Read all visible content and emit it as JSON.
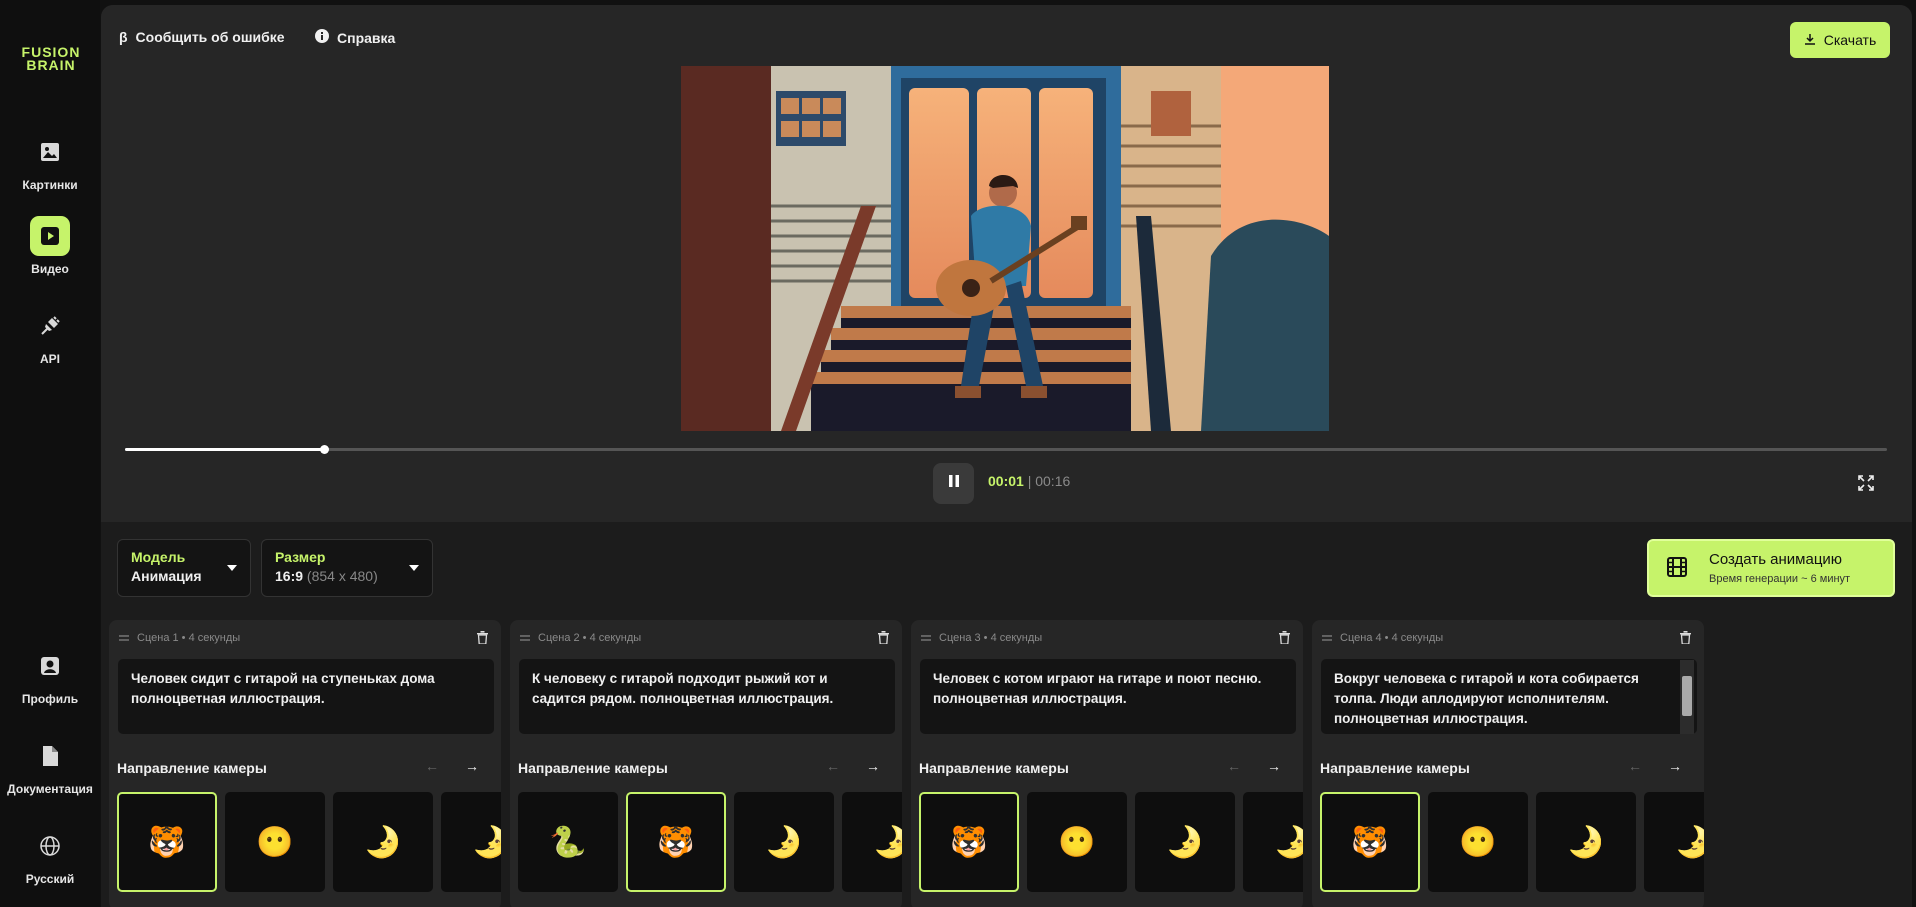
{
  "sidebar": {
    "logo": "FUSION BRAIN",
    "items": [
      {
        "label": "Картинки",
        "icon": "image-icon"
      },
      {
        "label": "Видео",
        "icon": "video-play-icon",
        "active": true
      },
      {
        "label": "API",
        "icon": "plug-icon"
      },
      {
        "label": "Профиль",
        "icon": "user-icon"
      },
      {
        "label": "Документация",
        "icon": "document-icon"
      },
      {
        "label": "Русский",
        "icon": "globe-icon"
      }
    ]
  },
  "header": {
    "report_bug": "Сообщить об ошибке",
    "help": "Справка",
    "download": "Скачать"
  },
  "player": {
    "current_time": "00:01",
    "separator": "|",
    "total_time": "00:16",
    "progress": 0.113
  },
  "controls": {
    "model_label": "Модель",
    "model_value": "Анимация",
    "size_label": "Размер",
    "size_ratio": "16:9",
    "size_pixels": "(854 x 480)",
    "create_title": "Создать анимацию",
    "create_subtitle": "Время генерации ~ 6 минут"
  },
  "scenes": [
    {
      "title": "Сцена 1 • 4 секунды",
      "prompt": "Человек сидит с гитарой на ступеньках дома полноцветная иллюстрация.",
      "camera_title": "Направление камеры",
      "arrow_left": "←",
      "arrow_right": "→",
      "thumbs": [
        "🐯",
        "😶",
        "🌛",
        "🌛"
      ],
      "selected": 0
    },
    {
      "title": "Сцена 2 • 4 секунды",
      "prompt": "К человеку с гитарой подходит рыжий кот и садится рядом.  полноцветная иллюстрация.",
      "camera_title": "Направление камеры",
      "arrow_left": "←",
      "arrow_right": "→",
      "thumbs": [
        "🐍",
        "🐯",
        "🌛",
        "🌛"
      ],
      "selected": 1
    },
    {
      "title": "Сцена 3 • 4 секунды",
      "prompt": "Человек с котом играют на гитаре и поют песню. полноцветная иллюстрация.",
      "camera_title": "Направление камеры",
      "arrow_left": "←",
      "arrow_right": "→",
      "thumbs": [
        "🐯",
        "😶",
        "🌛",
        "🌛"
      ],
      "selected": 0
    },
    {
      "title": "Сцена 4 • 4 секунды",
      "prompt": "Вокруг человека с гитарой и кота собирается толпа. Люди аплодируют исполнителям. полноцветная иллюстрация.",
      "camera_title": "Направление камеры",
      "arrow_left": "←",
      "arrow_right": "→",
      "thumbs": [
        "🐯",
        "😶",
        "🌛",
        "🌛"
      ],
      "selected": 0
    }
  ],
  "colors": {
    "accent": "#c6f36a",
    "background": "#1c1c1c",
    "panel": "#262626"
  }
}
